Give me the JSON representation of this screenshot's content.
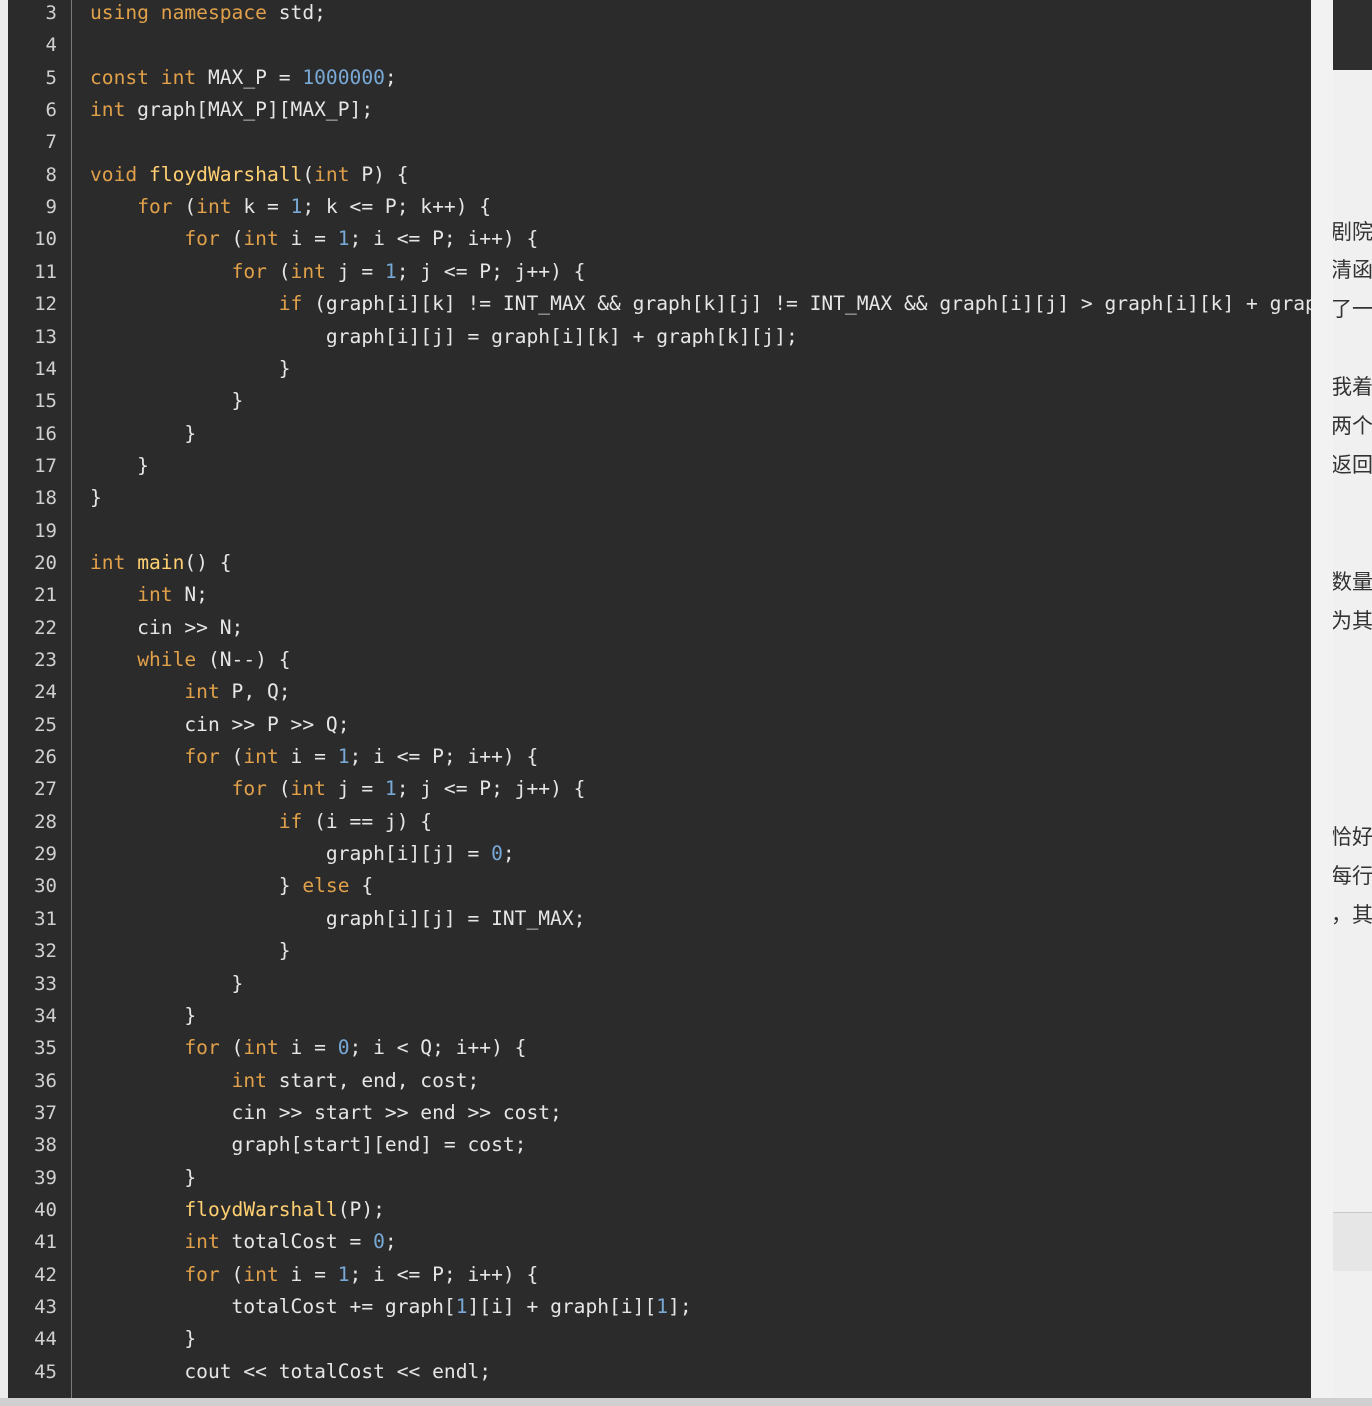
{
  "editor": {
    "lines": [
      {
        "n": "3",
        "tokens": [
          [
            "using",
            "kw"
          ],
          [
            " "
          ],
          [
            "namespace",
            "kw"
          ],
          [
            " std;"
          ]
        ]
      },
      {
        "n": "4",
        "tokens": []
      },
      {
        "n": "5",
        "tokens": [
          [
            "const",
            "kw"
          ],
          [
            " "
          ],
          [
            "int",
            "kw"
          ],
          [
            " MAX_P = "
          ],
          [
            "1000000",
            "num"
          ],
          [
            ";"
          ]
        ]
      },
      {
        "n": "6",
        "tokens": [
          [
            "int",
            "kw"
          ],
          [
            " graph[MAX_P][MAX_P];"
          ]
        ]
      },
      {
        "n": "7",
        "tokens": []
      },
      {
        "n": "8",
        "tokens": [
          [
            "void",
            "kw"
          ],
          [
            " "
          ],
          [
            "floydWarshall",
            "fn"
          ],
          [
            "("
          ],
          [
            "int",
            "kw"
          ],
          [
            " P) {"
          ]
        ]
      },
      {
        "n": "9",
        "tokens": [
          [
            "    "
          ],
          [
            "for",
            "kw"
          ],
          [
            " ("
          ],
          [
            "int",
            "kw"
          ],
          [
            " k = "
          ],
          [
            "1",
            "num"
          ],
          [
            "; k <= P; k++) {"
          ]
        ]
      },
      {
        "n": "10",
        "tokens": [
          [
            "        "
          ],
          [
            "for",
            "kw"
          ],
          [
            " ("
          ],
          [
            "int",
            "kw"
          ],
          [
            " i = "
          ],
          [
            "1",
            "num"
          ],
          [
            "; i <= P; i++) {"
          ]
        ]
      },
      {
        "n": "11",
        "tokens": [
          [
            "            "
          ],
          [
            "for",
            "kw"
          ],
          [
            " ("
          ],
          [
            "int",
            "kw"
          ],
          [
            " j = "
          ],
          [
            "1",
            "num"
          ],
          [
            "; j <= P; j++) {"
          ]
        ]
      },
      {
        "n": "12",
        "tokens": [
          [
            "                "
          ],
          [
            "if",
            "kw"
          ],
          [
            " (graph[i][k] != INT_MAX && graph[k][j] != INT_MAX && graph[i][j] > graph[i][k] + graph[k][j]) {"
          ]
        ]
      },
      {
        "n": "13",
        "tokens": [
          [
            "                    graph[i][j] = graph[i][k] + graph[k][j];"
          ]
        ]
      },
      {
        "n": "14",
        "tokens": [
          [
            "                }"
          ]
        ]
      },
      {
        "n": "15",
        "tokens": [
          [
            "            }"
          ]
        ]
      },
      {
        "n": "16",
        "tokens": [
          [
            "        }"
          ]
        ]
      },
      {
        "n": "17",
        "tokens": [
          [
            "    }"
          ]
        ]
      },
      {
        "n": "18",
        "tokens": [
          [
            "}"
          ]
        ]
      },
      {
        "n": "19",
        "tokens": []
      },
      {
        "n": "20",
        "tokens": [
          [
            "int",
            "kw"
          ],
          [
            " "
          ],
          [
            "main",
            "fn"
          ],
          [
            "() {"
          ]
        ]
      },
      {
        "n": "21",
        "tokens": [
          [
            "    "
          ],
          [
            "int",
            "kw"
          ],
          [
            " N;"
          ]
        ]
      },
      {
        "n": "22",
        "tokens": [
          [
            "    cin >> N;"
          ]
        ]
      },
      {
        "n": "23",
        "tokens": [
          [
            "    "
          ],
          [
            "while",
            "kw"
          ],
          [
            " (N--) {"
          ]
        ]
      },
      {
        "n": "24",
        "tokens": [
          [
            "        "
          ],
          [
            "int",
            "kw"
          ],
          [
            " P, Q;"
          ]
        ]
      },
      {
        "n": "25",
        "tokens": [
          [
            "        cin >> P >> Q;"
          ]
        ]
      },
      {
        "n": "26",
        "tokens": [
          [
            "        "
          ],
          [
            "for",
            "kw"
          ],
          [
            " ("
          ],
          [
            "int",
            "kw"
          ],
          [
            " i = "
          ],
          [
            "1",
            "num"
          ],
          [
            "; i <= P; i++) {"
          ]
        ]
      },
      {
        "n": "27",
        "tokens": [
          [
            "            "
          ],
          [
            "for",
            "kw"
          ],
          [
            " ("
          ],
          [
            "int",
            "kw"
          ],
          [
            " j = "
          ],
          [
            "1",
            "num"
          ],
          [
            "; j <= P; j++) {"
          ]
        ]
      },
      {
        "n": "28",
        "tokens": [
          [
            "                "
          ],
          [
            "if",
            "kw"
          ],
          [
            " (i == j) {"
          ]
        ]
      },
      {
        "n": "29",
        "tokens": [
          [
            "                    graph[i][j] = "
          ],
          [
            "0",
            "num"
          ],
          [
            ";"
          ]
        ]
      },
      {
        "n": "30",
        "tokens": [
          [
            "                } "
          ],
          [
            "else",
            "kw"
          ],
          [
            " {"
          ]
        ]
      },
      {
        "n": "31",
        "tokens": [
          [
            "                    graph[i][j] = INT_MAX;"
          ]
        ]
      },
      {
        "n": "32",
        "tokens": [
          [
            "                }"
          ]
        ]
      },
      {
        "n": "33",
        "tokens": [
          [
            "            }"
          ]
        ]
      },
      {
        "n": "34",
        "tokens": [
          [
            "        }"
          ]
        ]
      },
      {
        "n": "35",
        "tokens": [
          [
            "        "
          ],
          [
            "for",
            "kw"
          ],
          [
            " ("
          ],
          [
            "int",
            "kw"
          ],
          [
            " i = "
          ],
          [
            "0",
            "num"
          ],
          [
            "; i < Q; i++) {"
          ]
        ]
      },
      {
        "n": "36",
        "tokens": [
          [
            "            "
          ],
          [
            "int",
            "kw"
          ],
          [
            " start, end, cost;"
          ]
        ]
      },
      {
        "n": "37",
        "tokens": [
          [
            "            cin >> start >> end >> cost;"
          ]
        ]
      },
      {
        "n": "38",
        "tokens": [
          [
            "            graph[start][end] = cost;"
          ]
        ]
      },
      {
        "n": "39",
        "tokens": [
          [
            "        }"
          ]
        ]
      },
      {
        "n": "40",
        "tokens": [
          [
            "        "
          ],
          [
            "floydWarshall",
            "fn"
          ],
          [
            "(P);"
          ]
        ]
      },
      {
        "n": "41",
        "tokens": [
          [
            "        "
          ],
          [
            "int",
            "kw"
          ],
          [
            " totalCost = "
          ],
          [
            "0",
            "num"
          ],
          [
            ";"
          ]
        ]
      },
      {
        "n": "42",
        "tokens": [
          [
            "        "
          ],
          [
            "for",
            "kw"
          ],
          [
            " ("
          ],
          [
            "int",
            "kw"
          ],
          [
            " i = "
          ],
          [
            "1",
            "num"
          ],
          [
            "; i <= P; i++) {"
          ]
        ]
      },
      {
        "n": "43",
        "tokens": [
          [
            "            totalCost += graph["
          ],
          [
            "1",
            "num"
          ],
          [
            "][i] + graph[i]["
          ],
          [
            "1",
            "num"
          ],
          [
            "];"
          ]
        ]
      },
      {
        "n": "44",
        "tokens": [
          [
            "        }"
          ]
        ]
      },
      {
        "n": "45",
        "tokens": [
          [
            "        cout << totalCost << endl;"
          ]
        ]
      }
    ]
  },
  "right_panel": {
    "text_fragments": [
      "剧院",
      "清函",
      "了一",
      "我着",
      "两个",
      "返回",
      "数量",
      "为其",
      "恰好",
      "每行",
      "，其"
    ]
  },
  "colors": {
    "editor_bg": "#2b2b2b",
    "keyword": "#e1a04a",
    "function": "#ffd072",
    "number": "#79a9d6",
    "plain": "#e6e6e6",
    "line_number": "#d0d0d0"
  }
}
